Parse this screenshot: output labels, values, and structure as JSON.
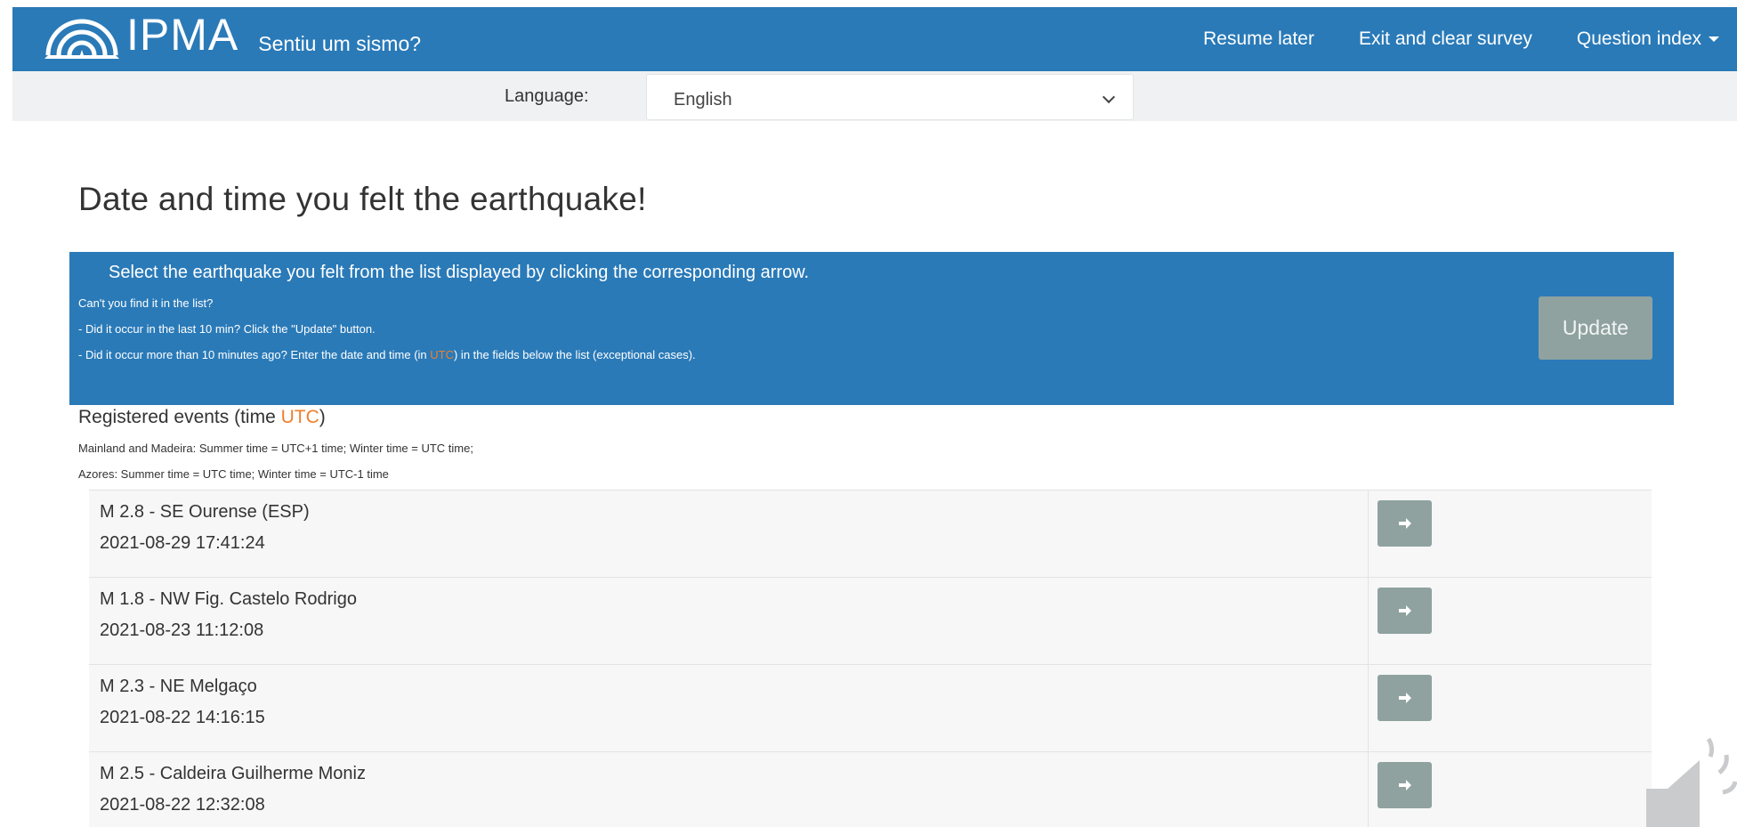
{
  "navbar": {
    "logo_text": "IPMA",
    "app_title": "Sentiu um sismo?",
    "links": {
      "resume_later": "Resume later",
      "exit_clear": "Exit and clear survey",
      "question_index": "Question index"
    }
  },
  "language": {
    "label": "Language:",
    "selected": "English"
  },
  "heading": "Date and time you felt the earthquake!",
  "info": {
    "main": "Select the earthquake you felt from the list displayed by clicking the corresponding arrow.",
    "line1": "Can't you find it in the list?",
    "line2": "- Did it occur in the last 10 min? Click the \"Update\" button.",
    "line3_before": "- Did it occur more than 10 minutes ago? Enter the date and time (in ",
    "line3_utc": "UTC",
    "line3_after": ") in the fields below the list (exceptional cases).",
    "update_label": "Update"
  },
  "registered": {
    "title_before": "Registered events (time ",
    "title_utc": "UTC",
    "title_after": ")",
    "note1": "Mainland and Madeira: Summer time = UTC+1 time; Winter time = UTC time;",
    "note2": "Azores: Summer time = UTC time; Winter time = UTC-1 time"
  },
  "events": [
    {
      "name": "M 2.8 - SE Ourense (ESP)",
      "time": "2021-08-29 17:41:24"
    },
    {
      "name": "M 1.8 - NW Fig. Castelo Rodrigo",
      "time": "2021-08-23 11:12:08"
    },
    {
      "name": "M 2.3 - NE Melgaço",
      "time": "2021-08-22 14:16:15"
    },
    {
      "name": "M 2.5 - Caldeira Guilherme Moniz",
      "time": "2021-08-22 12:32:08"
    }
  ],
  "colors": {
    "brand_blue": "#2a7ab8",
    "button_gray": "#8fa2a0",
    "utc_orange": "#f07f2c"
  },
  "icons": {
    "logo": "ipma-waves-icon",
    "arrow": "arrow-right-icon",
    "speaker": "speaker-icon"
  }
}
